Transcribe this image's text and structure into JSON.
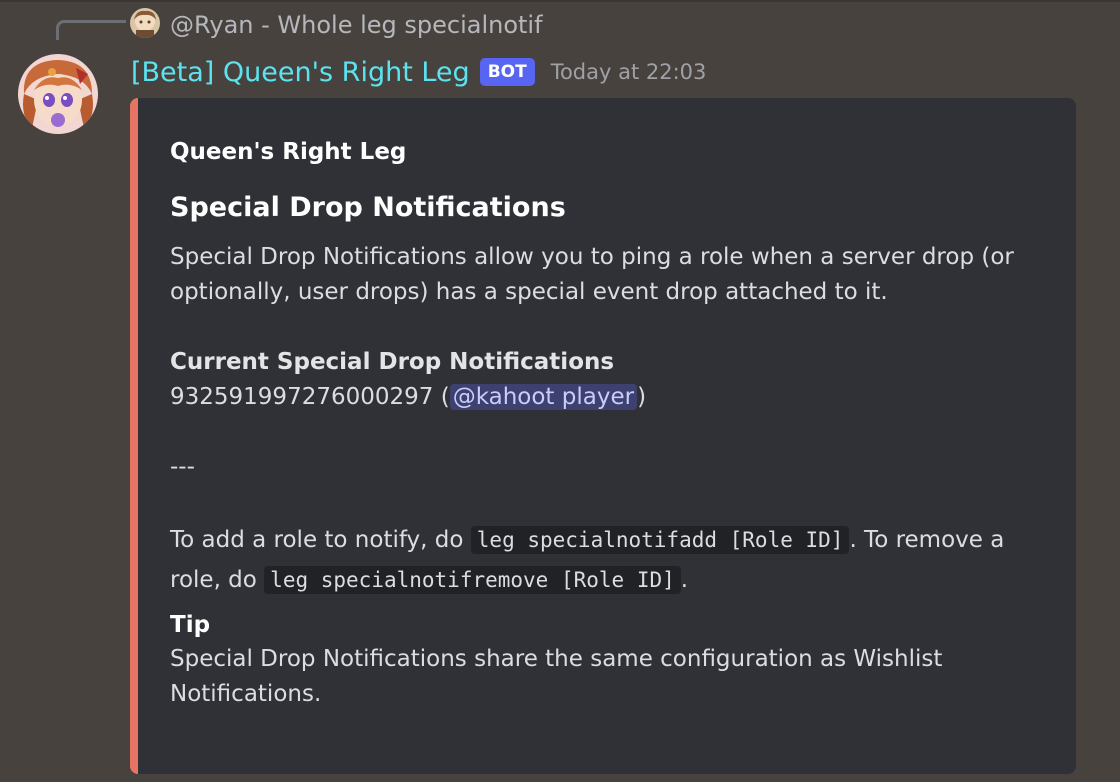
{
  "reply": {
    "text": "@Ryan - Whole leg specialnotif"
  },
  "message": {
    "author": "[Beta] Queen's Right Leg",
    "bot_tag": "BOT",
    "timestamp": "Today at 22:03"
  },
  "embed": {
    "accent_color": "#e67464",
    "author": "Queen's Right Leg",
    "title": "Special Drop Notifications",
    "description": {
      "intro": "Special Drop Notifications allow you to ping a role when a server drop (or optionally, user drops) has a special event drop attached to it.",
      "current_heading": "Current Special Drop Notifications",
      "role_id": "932591997276000297",
      "open_paren": " (",
      "role_mention": "@kahoot player",
      "close_paren": ")",
      "separator": "---",
      "add_prefix": "To add a role to notify, do ",
      "add_command": "leg specialnotifadd [Role ID]",
      "remove_prefix": ". To remove a role, do ",
      "remove_command": "leg specialnotifremove [Role ID]",
      "end_period": "."
    },
    "field": {
      "name": "Tip",
      "value": "Special Drop Notifications share the same configuration as Wishlist Notifications."
    }
  }
}
